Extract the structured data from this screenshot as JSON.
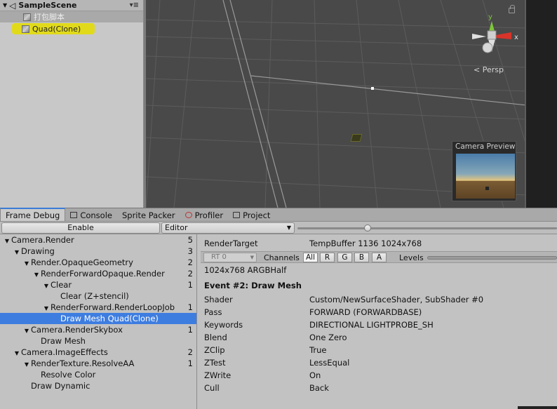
{
  "hierarchy": {
    "scene_name": "SampleScene",
    "items": [
      {
        "label": "打包脚本"
      },
      {
        "label": "Quad(Clone)"
      }
    ]
  },
  "scene_view": {
    "persp_label": "Persp",
    "gizmo_x_label": "x",
    "gizmo_y_label": "y",
    "camera_preview_title": "Camera Preview"
  },
  "tabs": [
    {
      "label": "Frame Debug"
    },
    {
      "label": "Console",
      "icon": "console-icon"
    },
    {
      "label": "Sprite Packer"
    },
    {
      "label": "Profiler",
      "icon": "profiler-icon"
    },
    {
      "label": "Project",
      "icon": "folder-icon"
    }
  ],
  "toolbar": {
    "enable_label": "Enable",
    "target_select": "Editor",
    "event_slider_fraction": 0.27
  },
  "tree": [
    {
      "label": "Camera.Render",
      "count": "5",
      "depth": 0,
      "expanded": true
    },
    {
      "label": "Drawing",
      "count": "3",
      "depth": 1,
      "expanded": true
    },
    {
      "label": "Render.OpaqueGeometry",
      "count": "2",
      "depth": 2,
      "expanded": true
    },
    {
      "label": "RenderForwardOpaque.Render",
      "count": "2",
      "depth": 3,
      "expanded": true
    },
    {
      "label": "Clear",
      "count": "1",
      "depth": 4,
      "expanded": true
    },
    {
      "label": "Clear (Z+stencil)",
      "count": "",
      "depth": 5,
      "expanded": false
    },
    {
      "label": "RenderForward.RenderLoopJob",
      "count": "1",
      "depth": 4,
      "expanded": true
    },
    {
      "label": "Draw Mesh Quad(Clone)",
      "count": "",
      "depth": 5,
      "expanded": false,
      "selected": true
    },
    {
      "label": "Camera.RenderSkybox",
      "count": "1",
      "depth": 2,
      "expanded": true
    },
    {
      "label": "Draw Mesh",
      "count": "",
      "depth": 3,
      "expanded": false
    },
    {
      "label": "Camera.ImageEffects",
      "count": "2",
      "depth": 1,
      "expanded": true
    },
    {
      "label": "RenderTexture.ResolveAA",
      "count": "1",
      "depth": 2,
      "expanded": true
    },
    {
      "label": "Resolve Color",
      "count": "",
      "depth": 3,
      "expanded": false
    },
    {
      "label": "Draw Dynamic",
      "count": "",
      "depth": 2,
      "expanded": false
    }
  ],
  "details": {
    "render_target_label": "RenderTarget",
    "render_target_value": "TempBuffer 1136 1024x768",
    "rt_select": "RT 0",
    "channels_label": "Channels",
    "channel_buttons": [
      "All",
      "R",
      "G",
      "B",
      "A"
    ],
    "levels_label": "Levels",
    "format": "1024x768 ARGBHalf",
    "event_title": "Event #2: Draw Mesh",
    "properties": [
      {
        "key": "Shader",
        "value": "Custom/NewSurfaceShader, SubShader #0"
      },
      {
        "key": "Pass",
        "value": "FORWARD (FORWARDBASE)"
      },
      {
        "key": "Keywords",
        "value": "DIRECTIONAL LIGHTPROBE_SH"
      },
      {
        "key": "Blend",
        "value": "One Zero"
      },
      {
        "key": "ZClip",
        "value": "True"
      },
      {
        "key": "ZTest",
        "value": "LessEqual"
      },
      {
        "key": "ZWrite",
        "value": "On"
      },
      {
        "key": "Cull",
        "value": "Back"
      }
    ]
  }
}
